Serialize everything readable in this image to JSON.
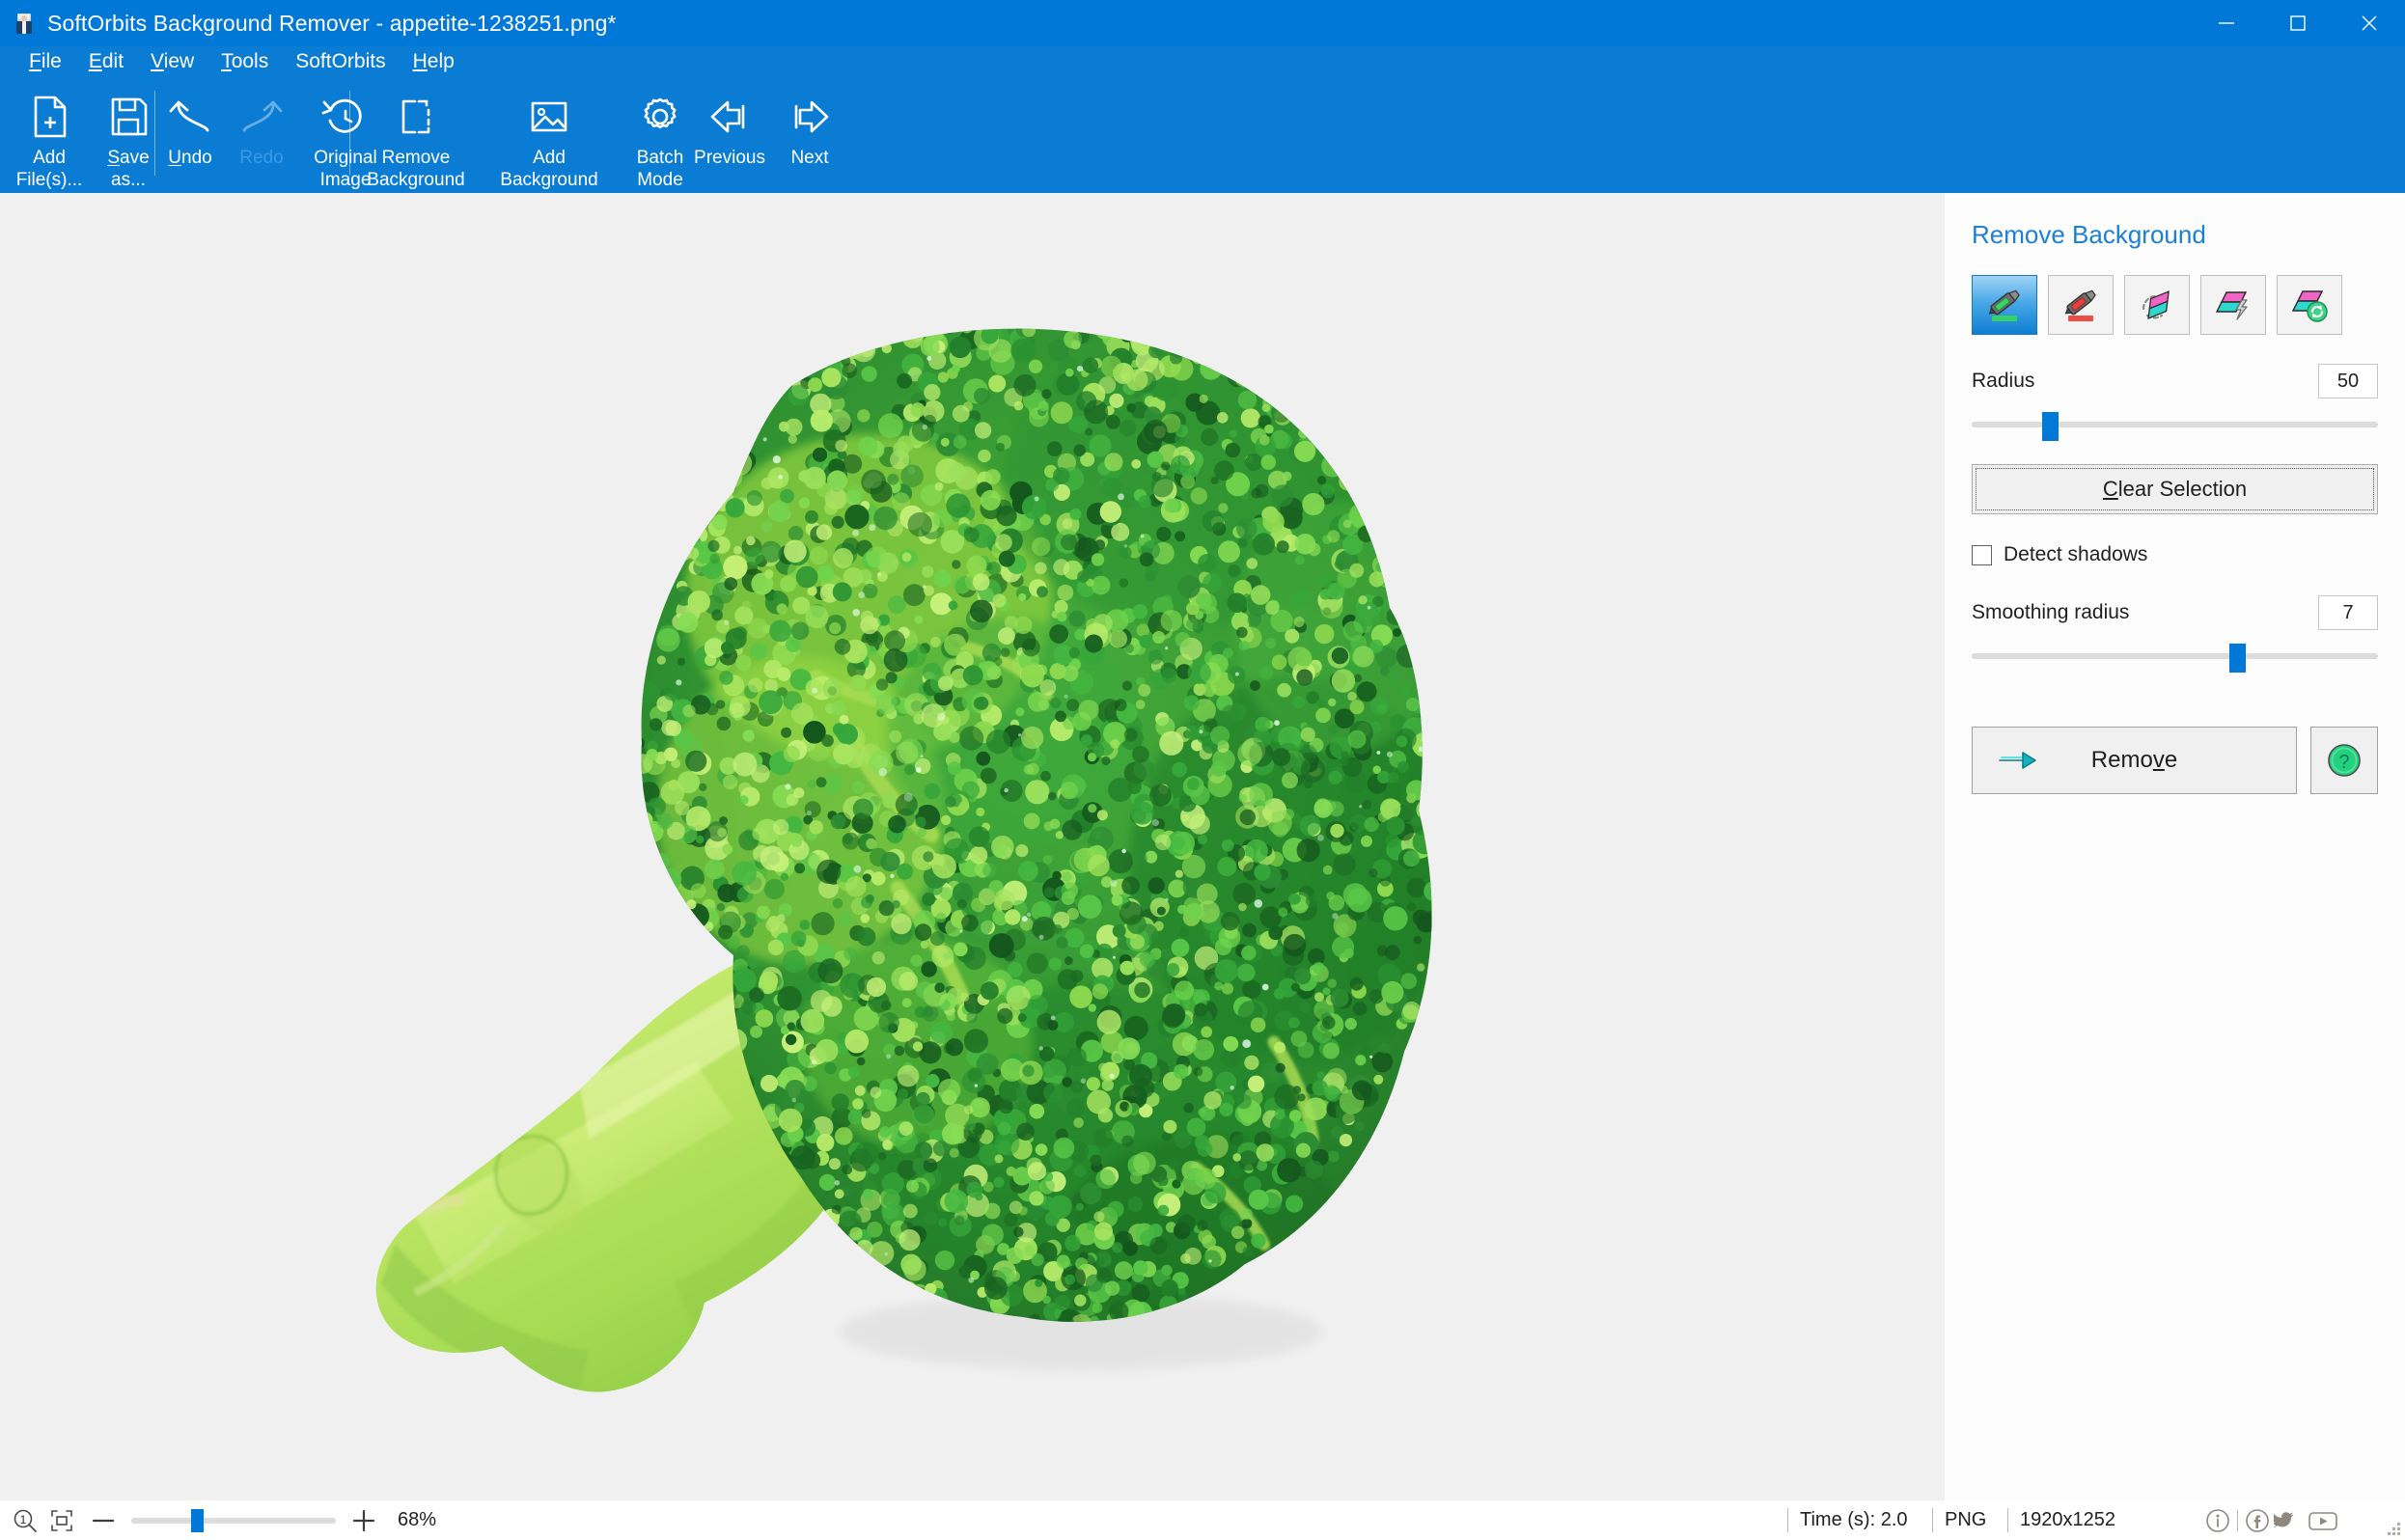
{
  "window": {
    "title": "SoftOrbits Background Remover - appetite-1238251.png*",
    "app_icon": "app-icon",
    "accent_color": "#0078d7",
    "controls": [
      {
        "name": "minimize",
        "glyph": "minimize-icon"
      },
      {
        "name": "maximize",
        "glyph": "maximize-icon"
      },
      {
        "name": "close",
        "glyph": "close-icon"
      }
    ]
  },
  "menubar": {
    "items": [
      {
        "label": "File",
        "mnemonic": "F"
      },
      {
        "label": "Edit",
        "mnemonic": "E"
      },
      {
        "label": "View",
        "mnemonic": "V"
      },
      {
        "label": "Tools",
        "mnemonic": "T"
      },
      {
        "label": "SoftOrbits",
        "mnemonic": ""
      },
      {
        "label": "Help",
        "mnemonic": "H"
      }
    ]
  },
  "toolbar": {
    "buttons": [
      {
        "id": "add-files",
        "label": "Add\nFile(s)...",
        "icon": "add-file-icon",
        "enabled": true,
        "mnemonic": ""
      },
      {
        "id": "save-as",
        "label": "Save\nas...",
        "icon": "save-icon",
        "enabled": true,
        "mnemonic": "S"
      },
      {
        "id": "undo",
        "label": "Undo",
        "icon": "undo-arrow-icon",
        "enabled": true,
        "mnemonic": "U"
      },
      {
        "id": "redo",
        "label": "Redo",
        "icon": "redo-arrow-icon",
        "enabled": false,
        "mnemonic": ""
      },
      {
        "id": "original-image",
        "label": "Original\nImage",
        "icon": "history-clock-icon",
        "enabled": true,
        "mnemonic": ""
      },
      {
        "id": "remove-background",
        "label": "Remove\nBackground",
        "icon": "crop-dashed-icon",
        "enabled": true,
        "mnemonic": ""
      },
      {
        "id": "add-background",
        "label": "Add\nBackground",
        "icon": "picture-icon",
        "enabled": true,
        "mnemonic": ""
      },
      {
        "id": "batch-mode",
        "label": "Batch\nMode",
        "icon": "gear-icon",
        "enabled": true,
        "mnemonic": ""
      },
      {
        "id": "previous",
        "label": "Previous",
        "icon": "arrow-left-icon",
        "enabled": true,
        "mnemonic": ""
      },
      {
        "id": "next",
        "label": "Next",
        "icon": "arrow-right-icon",
        "enabled": true,
        "mnemonic": ""
      }
    ]
  },
  "panel": {
    "title": "Remove Background",
    "tools": [
      {
        "id": "keep-marker",
        "icon": "green-marker-icon",
        "selected": true,
        "title": "Mark object to keep"
      },
      {
        "id": "remove-marker",
        "icon": "red-marker-icon",
        "selected": false,
        "title": "Mark background to remove"
      },
      {
        "id": "eraser",
        "icon": "eraser-icon",
        "selected": false,
        "title": "Eraser"
      },
      {
        "id": "magic-wand",
        "icon": "magic-wand-icon",
        "selected": false,
        "title": "Magic wand"
      },
      {
        "id": "auto-restore",
        "icon": "auto-restore-icon",
        "selected": false,
        "title": "Restore"
      }
    ],
    "radius": {
      "label": "Radius",
      "value": "50",
      "slider_percent": 18
    },
    "clear_selection": {
      "label": "Clear Selection",
      "mnemonic": "C",
      "focused": true
    },
    "detect_shadows": {
      "label": "Detect shadows",
      "checked": false
    },
    "smoothing_radius": {
      "label": "Smoothing radius",
      "value": "7",
      "slider_percent": 66
    },
    "remove": {
      "label": "Remove",
      "mnemonic": "v",
      "icon": "teal-arrow-icon"
    },
    "help": {
      "icon": "help-question-icon",
      "label": "?"
    }
  },
  "statusbar": {
    "zoom_one_to_one_icon": "zoom-actual-size-icon",
    "fit_window_icon": "fit-to-window-icon",
    "minus_icon": "zoom-out-icon",
    "plus_icon": "zoom-in-icon",
    "zoom_percent": "68%",
    "zoom_slider_percent": 31,
    "time": "Time (s): 2.0",
    "format": "PNG",
    "dimensions": "1920x1252",
    "social": [
      {
        "name": "info-icon"
      },
      {
        "name": "facebook-icon"
      },
      {
        "name": "twitter-icon"
      },
      {
        "name": "youtube-icon"
      }
    ]
  },
  "canvas": {
    "background_color": "#f0f0f0",
    "image_subject": "broccoli",
    "image_alpha_removed": true
  }
}
